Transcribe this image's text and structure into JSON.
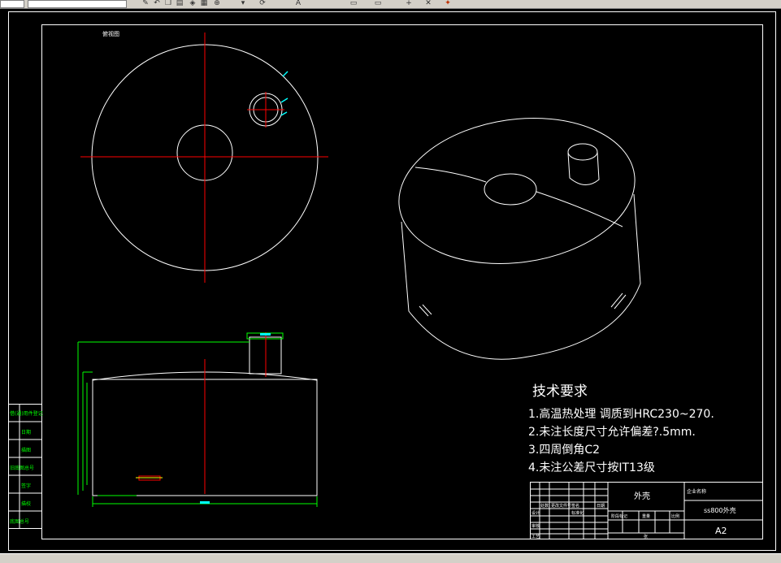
{
  "icons": [
    "field-icon",
    "pencil-icon",
    "undo-icon",
    "copy-icon",
    "paste-icon",
    "layer-icon",
    "arrow-down-icon",
    "refresh-icon",
    "grid-icon",
    "zoom-icon",
    "text-icon",
    "line-icon",
    "plus-icon",
    "cross-icon",
    "tool-icon"
  ],
  "drawing": {
    "top_view_label": "俯视图",
    "tech_requirements": {
      "title": "技术要求",
      "items": [
        "1.高温热处理  调质到HRC230~270.",
        "2.未注长度尺寸允许偏差?.5mm.",
        "3.四周倒角C2",
        "4.未注公差尺寸按IT13级"
      ]
    },
    "title_block": {
      "part_name": "外壳",
      "top_right": "企业名称",
      "drawing_no": "ss800外壳",
      "sheet_size": "A2",
      "row_labels": [
        "标记",
        "设计",
        "审核",
        "工艺"
      ],
      "col_labels": [
        "处数",
        "分区",
        "更改文件号",
        "签名",
        "日期"
      ],
      "std_label": "标准化",
      "scale_labels": [
        "阶段标记",
        "重量",
        "比例"
      ],
      "sheet_label": "张"
    },
    "side_stamps": [
      "借(通)用件登记",
      "旧底图总号",
      "底图总号",
      "签字",
      "日期",
      "描图",
      "描校"
    ]
  },
  "colors": {
    "line": "#ffffff",
    "center": "#ff0000",
    "dimension": "#00ff00",
    "accent": "#00ffff",
    "annot": "#ffff00",
    "background": "#000000"
  }
}
